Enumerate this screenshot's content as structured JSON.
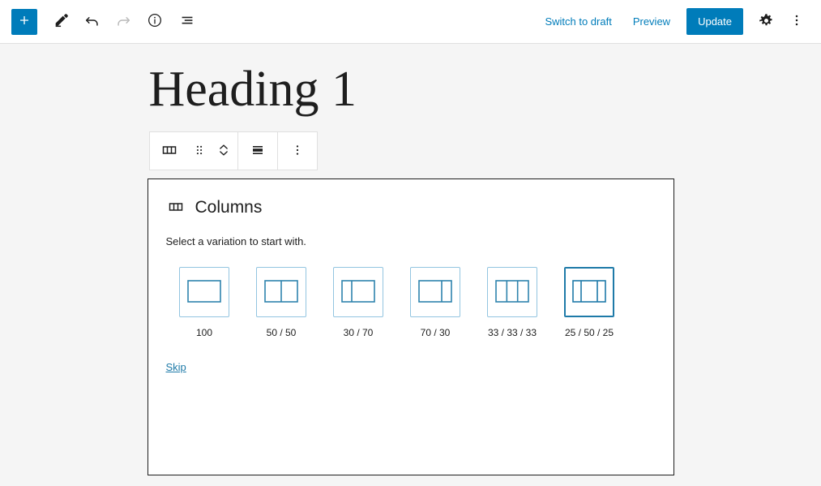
{
  "header": {
    "left_tools": [
      {
        "name": "block-inserter-button",
        "icon": "plus-icon",
        "label": "Toggle block inserter"
      },
      {
        "name": "tools-edit-button",
        "icon": "pencil-icon",
        "label": "Edit"
      },
      {
        "name": "undo-button",
        "icon": "undo-arrow-icon",
        "label": "Undo"
      },
      {
        "name": "redo-button",
        "icon": "redo-arrow-icon",
        "label": "Redo",
        "disabled": true
      },
      {
        "name": "details-button",
        "icon": "info-circle-icon",
        "label": "Details"
      },
      {
        "name": "list-view-button",
        "icon": "list-view-icon",
        "label": "List View"
      }
    ],
    "switch_to_draft_label": "Switch to draft",
    "preview_label": "Preview",
    "update_label": "Update",
    "settings_label": "Settings",
    "options_label": "Options",
    "accent_color": "#007cba"
  },
  "document": {
    "heading": "Heading 1"
  },
  "block_toolbar": {
    "buttons": [
      {
        "name": "block-type-columns-button",
        "icon": "columns-icon",
        "label": "Columns"
      },
      {
        "name": "drag-handle",
        "icon": "drag-dots-icon",
        "label": "Drag"
      },
      {
        "name": "move-up-down-button",
        "icon": "chevron-up-down-icon",
        "label": "Move up or down"
      },
      {
        "name": "change-vertical-alignment-button",
        "icon": "align-vertical-icon",
        "label": "Change vertical alignment"
      },
      {
        "name": "block-options-button",
        "icon": "vertical-dots-icon",
        "label": "Options"
      }
    ]
  },
  "placeholder": {
    "icon": "columns-icon",
    "title": "Columns",
    "instructions": "Select a variation to start with.",
    "skip_label": "Skip",
    "selected_variation": "25 / 50 / 25",
    "variations": [
      {
        "label": "100",
        "columns": [
          100
        ]
      },
      {
        "label": "50 / 50",
        "columns": [
          50,
          50
        ]
      },
      {
        "label": "30 / 70",
        "columns": [
          30,
          70
        ]
      },
      {
        "label": "70 / 30",
        "columns": [
          70,
          30
        ]
      },
      {
        "label": "33 / 33 / 33",
        "columns": [
          33,
          33,
          33
        ]
      },
      {
        "label": "25 / 50 / 25",
        "columns": [
          25,
          50,
          25
        ]
      }
    ],
    "outline_color": "#93c5e0",
    "selected_color": "#1e7aa8"
  }
}
